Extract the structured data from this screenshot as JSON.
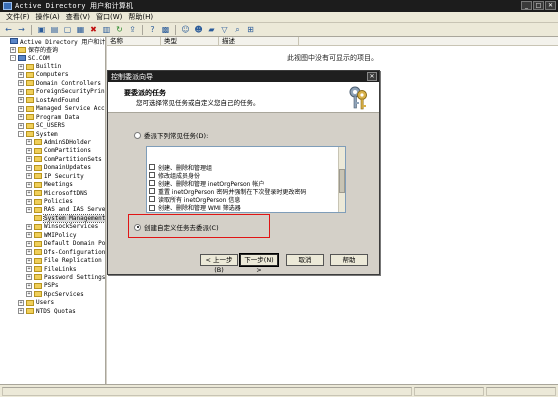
{
  "window": {
    "title": "Active Directory 用户和计算机",
    "controls": [
      "_",
      "□",
      "✕"
    ]
  },
  "menu": {
    "items": [
      "文件(F)",
      "操作(A)",
      "查看(V)",
      "窗口(W)",
      "帮助(H)"
    ]
  },
  "toolbar": {
    "icons": [
      "back-arrow-icon",
      "forward-arrow-icon",
      "up-folder-icon",
      "tree-toggle-icon",
      "copy-icon",
      "paste-icon",
      "delete-icon",
      "properties-icon",
      "refresh-icon",
      "export-icon",
      "help-icon",
      "console-icon",
      "new-user-icon",
      "new-group-icon",
      "new-ou-icon",
      "filter-icon",
      "find-icon",
      "add-to-group-icon"
    ]
  },
  "tree": {
    "items": [
      {
        "label": "Active Directory 用户和计算机",
        "indent": 0,
        "exp": "",
        "icon": "domain"
      },
      {
        "label": "保存的查询",
        "indent": 1,
        "exp": "+",
        "icon": "folder"
      },
      {
        "label": "SC.COM",
        "indent": 1,
        "exp": "-",
        "icon": "domain"
      },
      {
        "label": "Builtin",
        "indent": 2,
        "exp": "+",
        "icon": "folder"
      },
      {
        "label": "Computers",
        "indent": 2,
        "exp": "+",
        "icon": "folder"
      },
      {
        "label": "Domain Controllers",
        "indent": 2,
        "exp": "+",
        "icon": "folder"
      },
      {
        "label": "ForeignSecurityPrincip",
        "indent": 2,
        "exp": "+",
        "icon": "folder"
      },
      {
        "label": "LostAndFound",
        "indent": 2,
        "exp": "+",
        "icon": "folder"
      },
      {
        "label": "Managed Service Accour",
        "indent": 2,
        "exp": "+",
        "icon": "folder"
      },
      {
        "label": "Program Data",
        "indent": 2,
        "exp": "+",
        "icon": "folder"
      },
      {
        "label": "SC_USERS",
        "indent": 2,
        "exp": "+",
        "icon": "folder"
      },
      {
        "label": "System",
        "indent": 2,
        "exp": "-",
        "icon": "folder"
      },
      {
        "label": "AdminSDHolder",
        "indent": 3,
        "exp": "+",
        "icon": "folder"
      },
      {
        "label": "ComPartitions",
        "indent": 3,
        "exp": "+",
        "icon": "folder"
      },
      {
        "label": "ComPartitionSets",
        "indent": 3,
        "exp": "+",
        "icon": "folder"
      },
      {
        "label": "DomainUpdates",
        "indent": 3,
        "exp": "+",
        "icon": "folder"
      },
      {
        "label": "IP Security",
        "indent": 3,
        "exp": "+",
        "icon": "folder"
      },
      {
        "label": "Meetings",
        "indent": 3,
        "exp": "+",
        "icon": "folder"
      },
      {
        "label": "MicrosoftDNS",
        "indent": 3,
        "exp": "+",
        "icon": "folder"
      },
      {
        "label": "Policies",
        "indent": 3,
        "exp": "+",
        "icon": "folder"
      },
      {
        "label": "RAS and IAS Servers",
        "indent": 3,
        "exp": "+",
        "icon": "folder"
      },
      {
        "label": "System Management",
        "indent": 3,
        "exp": "",
        "icon": "folder",
        "selected": true
      },
      {
        "label": "WinsockServices",
        "indent": 3,
        "exp": "+",
        "icon": "folder"
      },
      {
        "label": "WMIPolicy",
        "indent": 3,
        "exp": "+",
        "icon": "folder"
      },
      {
        "label": "Default Domain Policy",
        "indent": 3,
        "exp": "+",
        "icon": "folder"
      },
      {
        "label": "Dfs-Configuration",
        "indent": 3,
        "exp": "+",
        "icon": "folder"
      },
      {
        "label": "File Replication Se",
        "indent": 3,
        "exp": "+",
        "icon": "folder"
      },
      {
        "label": "FileLinks",
        "indent": 3,
        "exp": "+",
        "icon": "folder"
      },
      {
        "label": "Password Settings C",
        "indent": 3,
        "exp": "+",
        "icon": "folder"
      },
      {
        "label": "PSPs",
        "indent": 3,
        "exp": "+",
        "icon": "folder"
      },
      {
        "label": "RpcServices",
        "indent": 3,
        "exp": "+",
        "icon": "folder"
      },
      {
        "label": "Users",
        "indent": 2,
        "exp": "+",
        "icon": "folder"
      },
      {
        "label": "NTDS Quotas",
        "indent": 2,
        "exp": "+",
        "icon": "folder"
      }
    ]
  },
  "list": {
    "columns": [
      "名称",
      "类型",
      "描述"
    ],
    "empty_text": "此视图中没有可显示的项目。"
  },
  "dialog": {
    "title": "控制委派向导",
    "close": "✕",
    "header_title": "要委派的任务",
    "header_subtitle": "您可选择常见任务或自定义您自己的任务。",
    "radio_common": "委派下列常见任务(D):",
    "radio_custom": "创建自定义任务去委派(C)",
    "selected_option": "custom",
    "tasks": [
      "创建、删除和管理组",
      "修改组成员身份",
      "创建、删除和管理 inetOrgPerson 帐户",
      "重置 inetOrgPerson 密码并强制在下次登录时更改密码",
      "读取所有 inetOrgPerson 信息",
      "创建、删除和管理 WMI 筛选器"
    ],
    "buttons": {
      "back": "< 上一步(B)",
      "next": "下一步(N) >",
      "cancel": "取消",
      "help": "帮助"
    },
    "highlight_color": "#e01515"
  }
}
